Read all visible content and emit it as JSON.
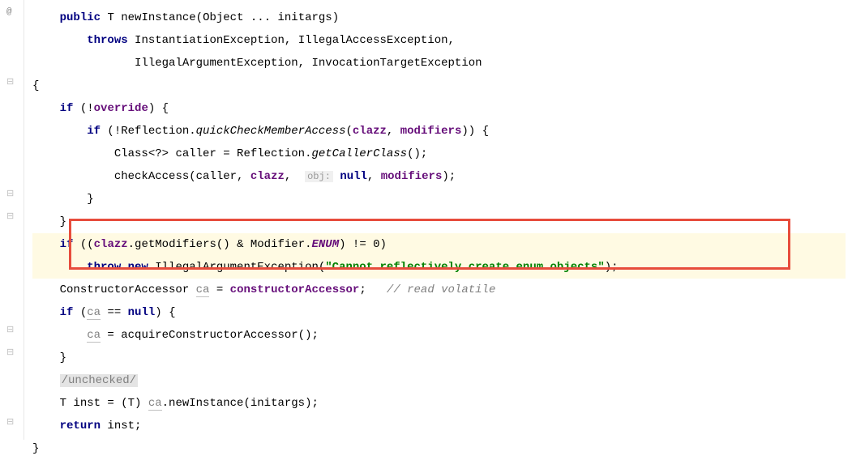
{
  "code": {
    "l1_public": "public",
    "l1_type": "T",
    "l1_method": "newInstance",
    "l1_params": "(Object ... initargs)",
    "l2_throws": "throws",
    "l2_ex1": "InstantiationException",
    "l2_c1": ", ",
    "l2_ex2": "IllegalAccessException",
    "l2_c2": ",",
    "l3_ex3": "IllegalArgumentException",
    "l3_c1": ", ",
    "l3_ex4": "InvocationTargetException",
    "l4_brace": "{",
    "l5_if": "if",
    "l5_cond": " (!",
    "l5_field": "override",
    "l5_end": ") {",
    "l6_if": "if",
    "l6_p1": " (!Reflection.",
    "l6_method": "quickCheckMemberAccess",
    "l6_p2": "(",
    "l6_arg1": "clazz",
    "l6_c1": ", ",
    "l6_arg2": "modifiers",
    "l6_p3": ")) {",
    "l7_t1": "Class<?> caller = Reflection.",
    "l7_method": "getCallerClass",
    "l7_t2": "();",
    "l8_t1": "checkAccess(caller, ",
    "l8_arg1": "clazz",
    "l8_c1": ", ",
    "l8_hint": "obj:",
    "l8_null": "null",
    "l8_c2": ", ",
    "l8_arg2": "modifiers",
    "l8_t2": ");",
    "l9_brace": "}",
    "l10_brace": "}",
    "l11_if": "if",
    "l11_p1": " ((",
    "l11_field": "clazz",
    "l11_t1": ".getModifiers() & Modifier.",
    "l11_static": "ENUM",
    "l11_t2": ") != ",
    "l11_zero": "0",
    "l11_t3": ")",
    "l12_throw": "throw new",
    "l12_t1": " IllegalArgumentException(",
    "l12_string": "\"Cannot reflectively create enum objects\"",
    "l12_t2": ");",
    "l13_t1": "ConstructorAccessor ",
    "l13_var": "ca",
    "l13_t2": " = ",
    "l13_field": "constructorAccessor",
    "l13_t3": ";   ",
    "l13_comment": "// read volatile",
    "l14_if": "if",
    "l14_t1": " (",
    "l14_var": "ca",
    "l14_t2": " == ",
    "l14_null": "null",
    "l14_t3": ") {",
    "l15_var": "ca",
    "l15_t1": " = acquireConstructorAccessor();",
    "l16_brace": "}",
    "l17_anno": "/unchecked/",
    "l18_t1": "T inst = (T) ",
    "l18_var": "ca",
    "l18_t2": ".newInstance(initargs);",
    "l19_return": "return",
    "l19_t1": " inst;",
    "l20_brace": "}"
  },
  "gutter": {
    "at_symbol": "@"
  }
}
